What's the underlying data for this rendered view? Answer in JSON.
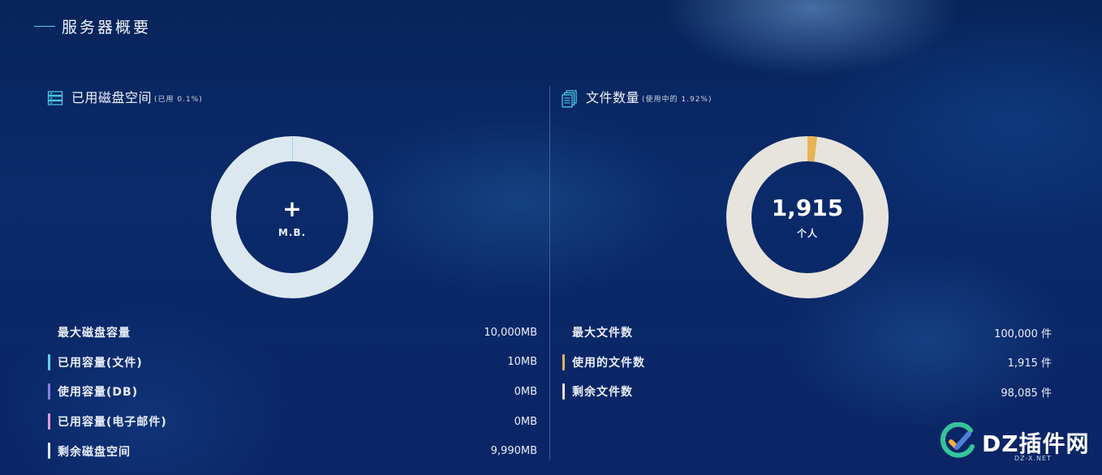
{
  "header": {
    "title": "服务器概要"
  },
  "disk": {
    "title": "已用磁盘空间",
    "subtitle": "(已用 0.1%)",
    "center_value": "+",
    "center_unit": "M.B.",
    "used_fraction": 0.001,
    "rows": [
      {
        "label": "最大磁盘容量",
        "value": "10,000MB",
        "color": ""
      },
      {
        "label": "已用容量(文件)",
        "value": "10MB",
        "color": "#5fd0e6"
      },
      {
        "label": "使用容量(DB)",
        "value": "0MB",
        "color": "#8a7fe0"
      },
      {
        "label": "已用容量(电子邮件)",
        "value": "0MB",
        "color": "#e29ad8"
      },
      {
        "label": "剩余磁盘空间",
        "value": "9,990MB",
        "color": "#dfe8f0"
      }
    ],
    "ring_color": "#dce8ef"
  },
  "files": {
    "title": "文件数量",
    "subtitle": "(使用中的 1.92%)",
    "center_value": "1,915",
    "center_unit": "个人",
    "used_fraction": 0.0192,
    "rows": [
      {
        "label": "最大文件数",
        "value": "100,000 件",
        "color": ""
      },
      {
        "label": "使用的文件数",
        "value": "1,915 件",
        "color": "#e7b354"
      },
      {
        "label": "剩余文件数",
        "value": "98,085 件",
        "color": "#e8e4dc"
      }
    ],
    "ring_color": "#e7e4dd",
    "used_color": "#e7b354"
  },
  "watermark": {
    "text": "DZ插件网",
    "sub": "DZ-X.NET"
  }
}
